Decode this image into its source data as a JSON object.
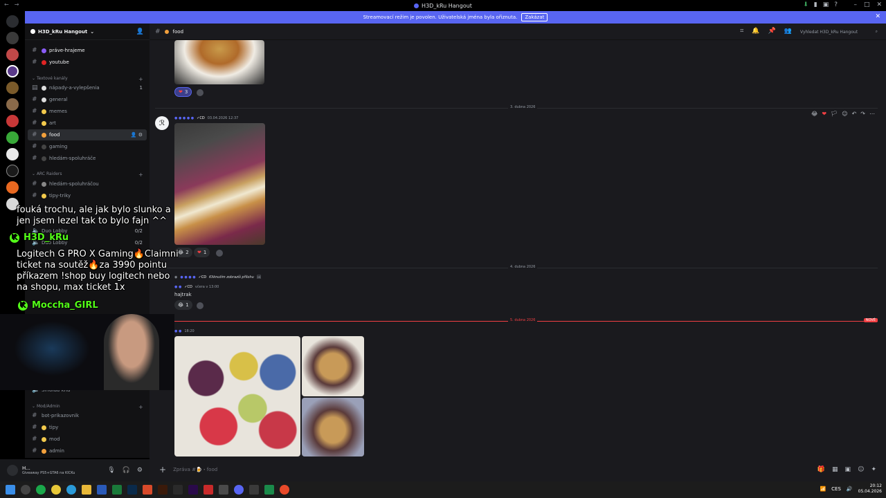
{
  "window": {
    "title": "H3D_kRu Hangout"
  },
  "banner": {
    "text": "Streamovací režim je povolen. Uživatelská jména byla ořiznuta.",
    "button": "Zakázat"
  },
  "server": {
    "name": "H3D_kRu Hangout"
  },
  "sidebar": {
    "channels_top": [
      {
        "label": "práve-hrajeme",
        "color": "#8a5cf6"
      },
      {
        "label": "youtube",
        "color": "#e02424"
      }
    ],
    "categories": {
      "text": "Textové kanály",
      "arc": "ARC Raiders",
      "mod": "Mod/Admin"
    },
    "text_channels": [
      {
        "label": "nápady-a-vylepšenia",
        "badge": "1"
      },
      {
        "label": "general"
      },
      {
        "label": "memes"
      },
      {
        "label": "art"
      },
      {
        "label": "food"
      },
      {
        "label": "gaming"
      },
      {
        "label": "hledám-spoluhráče"
      }
    ],
    "arc_channels": [
      {
        "label": "hledám-spoluhráčou"
      },
      {
        "label": "tipy-triky"
      }
    ],
    "voice": [
      {
        "label": "Duo Lobby",
        "count": "0/2"
      },
      {
        "label": "Duo Lobby",
        "count": "0/2"
      }
    ],
    "smolda": "Smolda kRu",
    "mod_channels": [
      {
        "label": "bot-prikazovnik"
      },
      {
        "label": "tipy"
      },
      {
        "label": "mod"
      },
      {
        "label": "admin"
      }
    ]
  },
  "user_panel": {
    "name": "H...",
    "status": "Giveaway PS5+GTA6 na KICKu"
  },
  "channel": {
    "name": "food",
    "search_placeholder": "Vyhledat H3D_kRu Hangout",
    "composer_placeholder": "Zpráva #🍺・food"
  },
  "messages": {
    "reaction_heart": "3",
    "divider_1": "3. dubna 2026",
    "msg1_time": "03.04.2026 12:37",
    "msg1_reactions": [
      {
        "emoji": "😂",
        "count": "2"
      },
      {
        "emoji": "❤",
        "count": "1"
      }
    ],
    "divider_2": "4. dubna 2026",
    "msg2_time": "včera v 13:00",
    "msg2_hint": "Kliknutím zobrazíš přílohu",
    "msg2_text": "hajtrak",
    "msg2_reaction": {
      "emoji": "😂",
      "count": "1"
    },
    "divider_new": "5. dubna 2026",
    "new_tag": "NOVÉ",
    "msg3_time": "18:20"
  },
  "overlay": {
    "chat1": "fouká trochu, ale jak bylo slunko a jen jsem lezel tak to bylo fajn ^^",
    "user1": "H3D_kRu",
    "chat2": "Logitech G PRO X Gaming🔥Claimni ticket na soutěž🔥za 3990 pointu příkazem !shop buy logitech nebo na shopu, max ticket 1x",
    "user2": "Moccha_GIRL"
  },
  "taskbar": {
    "lang": "CES",
    "time": "20:12",
    "date": "05.04.2026"
  }
}
